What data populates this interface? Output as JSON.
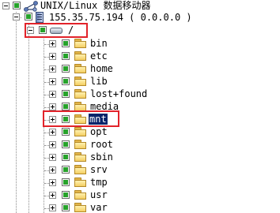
{
  "tree": {
    "root": {
      "label": "UNIX/Linux 数据移动器",
      "icon": "network-share-icon",
      "expanded": true
    },
    "host": {
      "label": "155.35.75.194 ( 0.0.0.0 )",
      "icon": "server-icon",
      "expanded": true
    },
    "drive": {
      "label": "/",
      "icon": "drive-icon",
      "expanded": true,
      "highlighted": true
    },
    "folders": [
      {
        "label": "bin"
      },
      {
        "label": "etc"
      },
      {
        "label": "home"
      },
      {
        "label": "lib"
      },
      {
        "label": "lost+found"
      },
      {
        "label": "media"
      },
      {
        "label": "mnt",
        "selected": true,
        "highlighted": true
      },
      {
        "label": "opt"
      },
      {
        "label": "root"
      },
      {
        "label": "sbin"
      },
      {
        "label": "srv"
      },
      {
        "label": "tmp"
      },
      {
        "label": "usr"
      },
      {
        "label": "var"
      }
    ]
  },
  "colors": {
    "state_green": "#27a22b",
    "highlight_red": "#e2232a",
    "selection_blue": "#0a246a",
    "folder_yellow": "#f4cf62"
  }
}
